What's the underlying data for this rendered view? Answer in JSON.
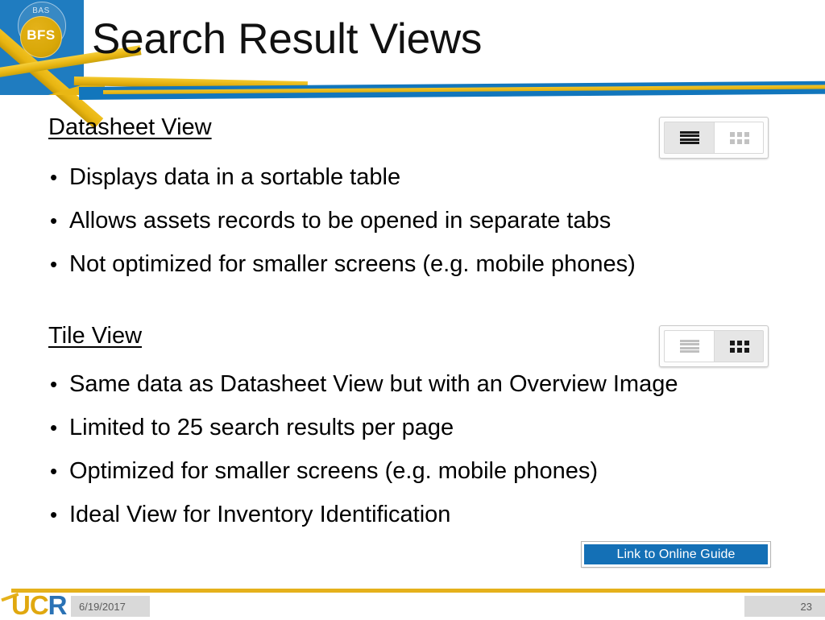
{
  "header": {
    "title": "Search Result Views",
    "logo": {
      "outer_text": "BAS",
      "inner_text": "BFS"
    },
    "colors": {
      "blue": "#1f7cc0",
      "gold": "#e5b11b"
    }
  },
  "content": {
    "sections": [
      {
        "heading": "Datasheet View",
        "bullets": [
          "Displays data in a sortable table",
          "Allows assets records to be opened in separate tabs",
          "Not optimized for smaller screens (e.g. mobile phones)"
        ],
        "toggle": {
          "list_label": "list-view",
          "grid_label": "grid-view",
          "active": "list"
        }
      },
      {
        "heading": "Tile View",
        "bullets": [
          "Same data as Datasheet View but with an Overview Image",
          "Limited to 25 search results per page",
          "Optimized for smaller screens (e.g. mobile phones)",
          "Ideal View for Inventory Identification"
        ],
        "toggle": {
          "list_label": "list-view",
          "grid_label": "grid-view",
          "active": "grid"
        }
      }
    ],
    "bullet_glyph": "•",
    "link_button": {
      "label": "Link to Online Guide",
      "color": "#1470b6"
    }
  },
  "footer": {
    "logo_uc": "UC",
    "logo_r": "R",
    "date": "6/19/2017",
    "slide_number": "23"
  }
}
